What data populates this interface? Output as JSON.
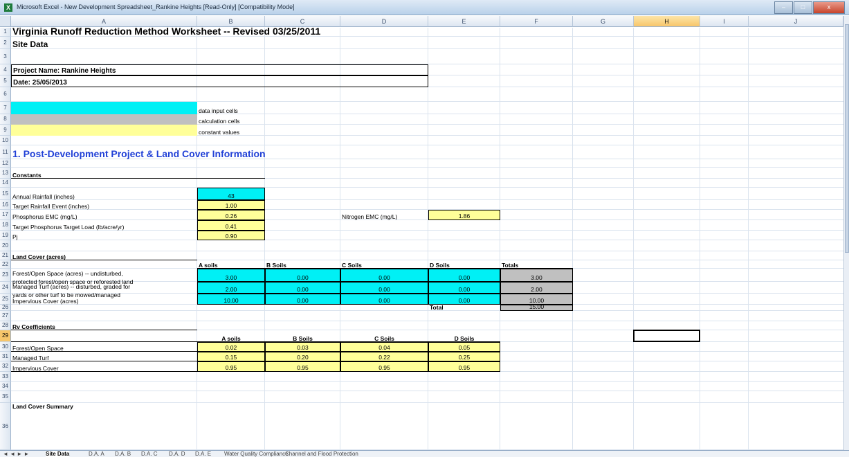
{
  "window": {
    "title": "Microsoft Excel - New Development Spreadsheet_Rankine Heights  [Read-Only]  [Compatibility Mode]",
    "app_icon": "X",
    "minimize": "–",
    "maximize": "□",
    "close": "x"
  },
  "columns": [
    "A",
    "B",
    "C",
    "D",
    "E",
    "F",
    "G",
    "H",
    "I",
    "J"
  ],
  "rows": [
    "1",
    "2",
    "3",
    "4",
    "5",
    "6",
    "7",
    "8",
    "9",
    "10",
    "11",
    "12",
    "13",
    "14",
    "15",
    "16",
    "17",
    "18",
    "19",
    "20",
    "21",
    "22",
    "23",
    "24",
    "25",
    "26",
    "27",
    "28",
    "29",
    "30",
    "31",
    "32",
    "33",
    "34",
    "35",
    "36"
  ],
  "sheet": {
    "title": "Virginia Runoff Reduction Method Worksheet -- Revised 03/25/2011",
    "subtitle": "Site Data",
    "project_name": "Project Name: Rankine Heights",
    "date": "Date: 25/05/2013",
    "legend": {
      "input": "data input cells",
      "calc": "calculation cells",
      "const": "constant values"
    },
    "section1": "1. Post-Development Project & Land Cover Information",
    "constants_label": "Constants",
    "constants": [
      {
        "label": "Annual Rainfall (inches)",
        "value": "43",
        "style": "cyan"
      },
      {
        "label": "Target Rainfall Event (inches)",
        "value": "1.00",
        "style": "yel"
      },
      {
        "label": "Phosphorus EMC (mg/L)",
        "value": "0.26",
        "style": "yel"
      },
      {
        "label": "Target Phosphorus Target Load (lb/acre/yr)",
        "value": "0.41",
        "style": "yel"
      },
      {
        "label": "Pj",
        "value": "0.90",
        "style": "yel"
      }
    ],
    "nitrogen": {
      "label": "Nitrogen EMC (mg/L)",
      "value": "1.86"
    },
    "land_cover_label": "Land Cover  (acres)",
    "land_cover_headers": [
      "A soils",
      "B Soils",
      "C Soils",
      "D Soils",
      "Totals"
    ],
    "land_cover": [
      {
        "label1": "Forest/Open Space (acres) -- undisturbed,",
        "label2": "protected forest/open space or reforested land",
        "values": [
          "3.00",
          "0.00",
          "0.00",
          "0.00"
        ],
        "total": "3.00"
      },
      {
        "label1": "Managed Turf (acres) -- disturbed, graded for",
        "label2": "yards or other turf to be mowed/managed",
        "values": [
          "2.00",
          "0.00",
          "0.00",
          "0.00"
        ],
        "total": "2.00"
      },
      {
        "label1": "",
        "label2": "Impervious Cover (acres)",
        "values": [
          "10.00",
          "0.00",
          "0.00",
          "0.00"
        ],
        "total": "10.00"
      }
    ],
    "total_label": "Total",
    "total_value": "15.00",
    "rv_label": "Rv Coefficients",
    "rv_headers": [
      "A soils",
      "B Soils",
      "C Soils",
      "D Soils"
    ],
    "rv": [
      {
        "label": "Forest/Open Space",
        "values": [
          "0.02",
          "0.03",
          "0.04",
          "0.05"
        ]
      },
      {
        "label": "Managed Turf",
        "values": [
          "0.15",
          "0.20",
          "0.22",
          "0.25"
        ]
      },
      {
        "label": "Impervious Cover",
        "values": [
          "0.95",
          "0.95",
          "0.95",
          "0.95"
        ]
      }
    ],
    "summary_label": "Land Cover Summary"
  },
  "tabs": {
    "nav": "◄ ◄ ► ►",
    "items": [
      "Site Data",
      "D.A. A",
      "D.A. B",
      "D.A. C",
      "D.A. D",
      "D.A. E",
      "Water Quality Compliance",
      "Channel and Flood Protection"
    ],
    "active": "Site Data"
  },
  "colors": {
    "input": "#00f0f5",
    "calc": "#c0c0c0",
    "const": "#ffff99",
    "section_title": "#1f3fd6"
  }
}
